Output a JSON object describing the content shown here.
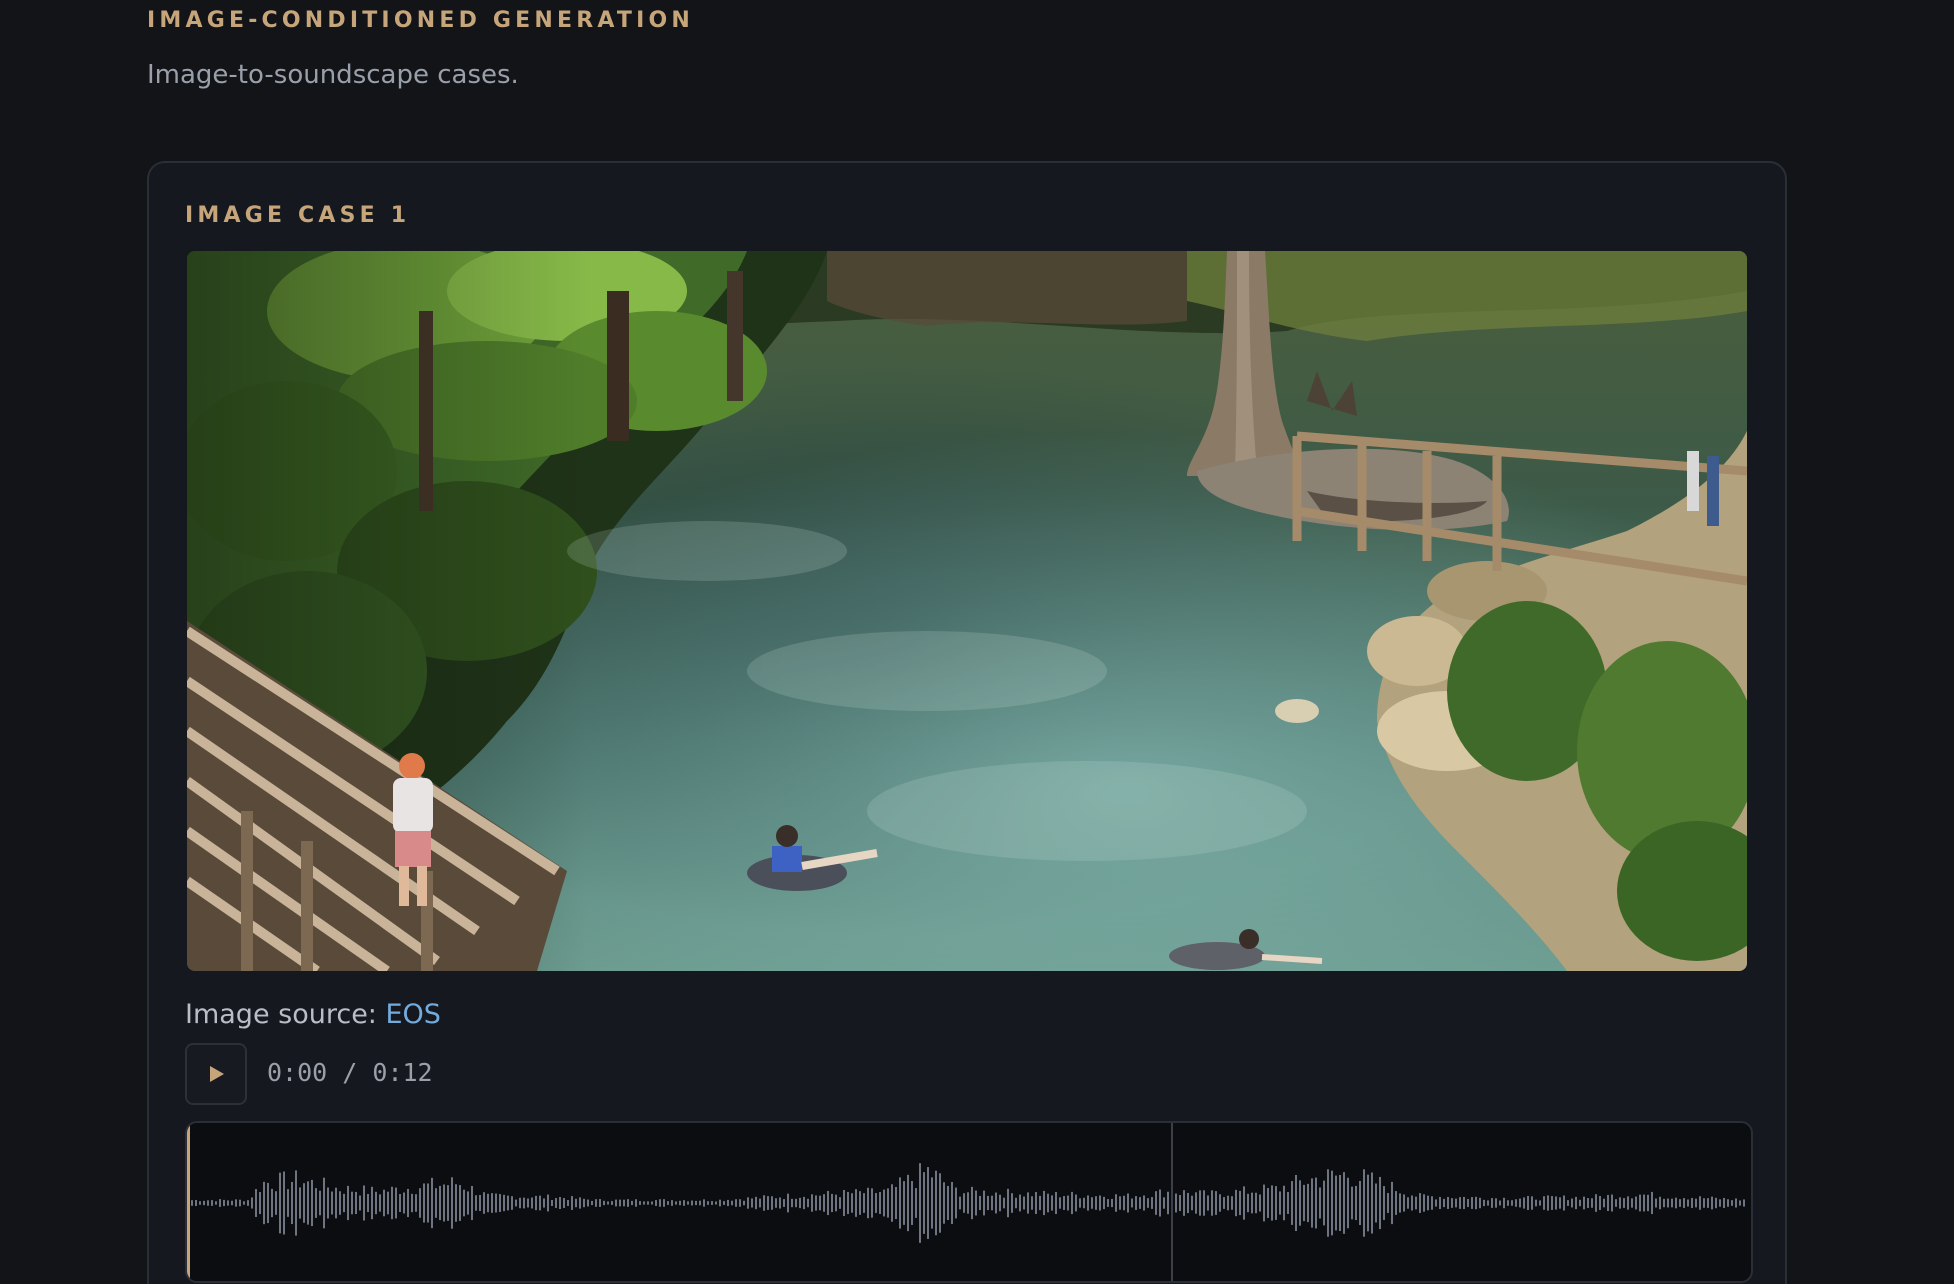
{
  "section": {
    "eyebrow": "IMAGE-CONDITIONED GENERATION",
    "subtitle": "Image-to-soundscape cases."
  },
  "case": {
    "title": "IMAGE CASE 1",
    "image_alt": "Spring river with swimmers on tubes, wooden stairs and a cypress tree",
    "source_label": "Image source:",
    "source_link": "EOS",
    "player": {
      "play_icon": "play-icon",
      "current_time": "0:00",
      "separator": "/",
      "duration": "0:12",
      "progress": 0.0
    }
  },
  "colors": {
    "accent": "#c7a57b",
    "link": "#72acde",
    "background": "#121418",
    "waveform": "#6f7580",
    "playhead": "#c7a57b"
  }
}
